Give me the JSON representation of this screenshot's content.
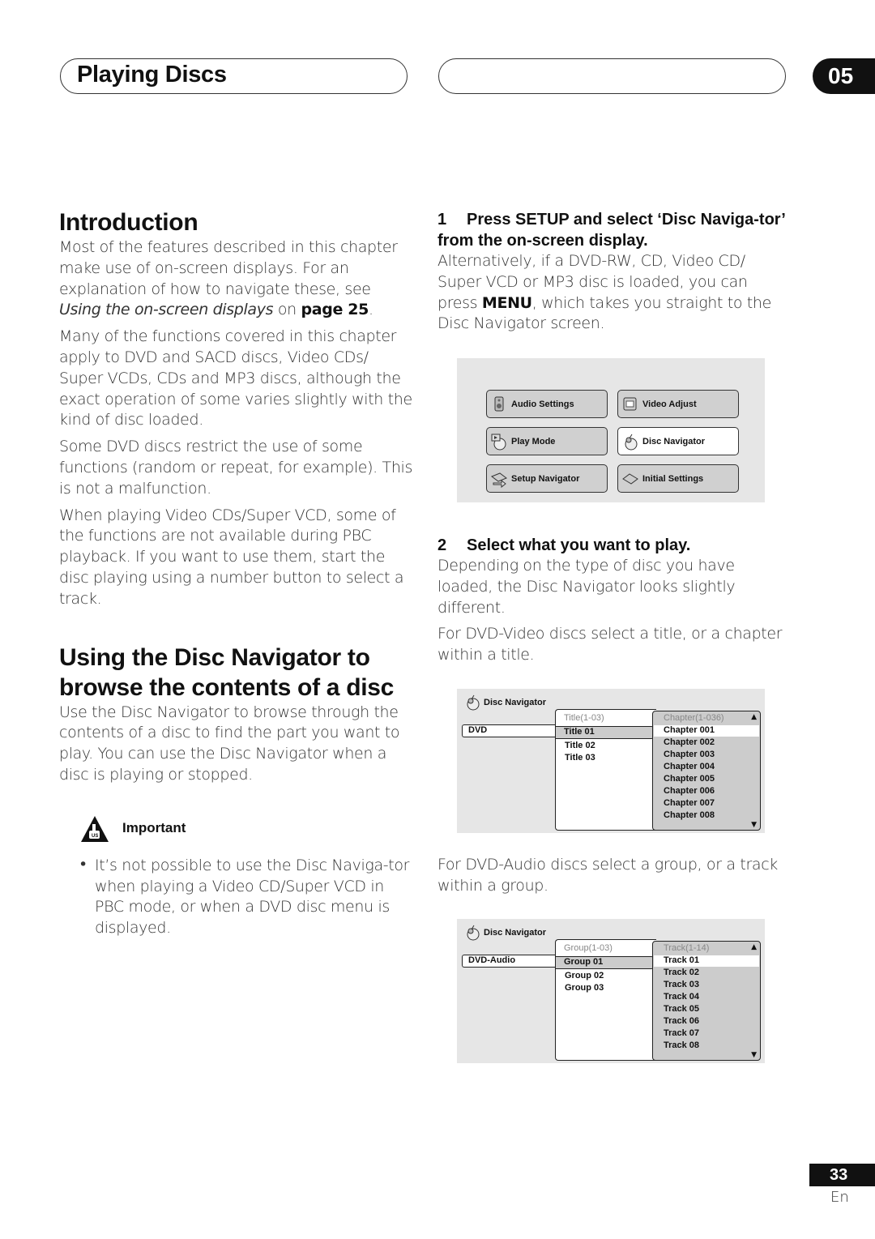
{
  "header": {
    "section_title": "Playing Discs",
    "chapter_number": "05"
  },
  "intro": {
    "heading": "Introduction",
    "p1_text": "Most of the features described in this chapter make use of on-screen displays. For an explanation of how to navigate these, see ",
    "p1_ref_italic": "Using the on-screen displays",
    "p1_on": " on ",
    "p1_page": "page 25",
    "p1_end": ".",
    "p2": "Many of the functions covered in this chapter apply to DVD and SACD discs, Video CDs/ Super VCDs, CDs and MP3 discs, although the exact operation of some varies slightly with the kind of disc loaded.",
    "p3": "Some DVD discs restrict the use of some functions (random or repeat, for example). This is not a malfunction.",
    "p4": "When playing Video CDs/Super VCD, some of the functions are not available during PBC playback. If you want to use them, start the disc playing using a number button to select a track."
  },
  "disc_nav_section": {
    "heading": "Using the Disc Navigator to browse the contents of a disc",
    "p1": "Use the Disc Navigator to browse through the contents of a disc to find the part you want to play. You can use the Disc Navigator when a disc is playing or stopped.",
    "important_label": "Important",
    "important_bullet": "It’s not possible to use the Disc Naviga-tor when playing a Video CD/Super VCD in PBC mode, or when a DVD disc menu is displayed."
  },
  "step1": {
    "number": "1",
    "title": "Press SETUP and select ‘Disc Naviga-tor’ from the on-screen display.",
    "text_a": "Alternatively, if a DVD-RW, CD, Video CD/ Super VCD or MP3 disc is loaded, you can press ",
    "text_bold": "MENU",
    "text_b": ", which takes you straight to the Disc Navigator screen."
  },
  "setup_menu": {
    "buttons": [
      {
        "label": "Audio Settings",
        "icon": "speaker-icon",
        "active": false
      },
      {
        "label": "Video Adjust",
        "icon": "monitor-icon",
        "active": false
      },
      {
        "label": "Play Mode",
        "icon": "play-mode-disc-icon",
        "active": false
      },
      {
        "label": "Disc Navigator",
        "icon": "disc-navigator-icon",
        "active": true
      },
      {
        "label": "Setup Navigator",
        "icon": "setup-navigator-icon",
        "active": false
      },
      {
        "label": "Initial Settings",
        "icon": "initial-settings-icon",
        "active": false
      }
    ]
  },
  "step2": {
    "number": "2",
    "title": "Select what you want to play.",
    "p1": "Depending on the type of disc you have loaded, the Disc Navigator looks slightly different.",
    "p2": "For DVD-Video discs select a title, or a chapter within a title.",
    "p3": "For DVD-Audio discs select a group, or a track within a group."
  },
  "dvd_navigator": {
    "title": "Disc Navigator",
    "disc_type": "DVD",
    "mid_header": "Title(1-03)",
    "mid_items": [
      "Title 01",
      "Title 02",
      "Title 03"
    ],
    "right_header": "Chapter(1-036)",
    "right_items": [
      "Chapter 001",
      "Chapter 002",
      "Chapter 003",
      "Chapter 004",
      "Chapter 005",
      "Chapter 006",
      "Chapter 007",
      "Chapter 008"
    ]
  },
  "dvda_navigator": {
    "title": "Disc Navigator",
    "disc_type": "DVD-Audio",
    "mid_header": "Group(1-03)",
    "mid_items": [
      "Group 01",
      "Group 02",
      "Group 03"
    ],
    "right_header": "Track(1-14)",
    "right_items": [
      "Track 01",
      "Track 02",
      "Track 03",
      "Track 04",
      "Track 05",
      "Track 06",
      "Track 07",
      "Track 08"
    ]
  },
  "footer": {
    "page_number": "33",
    "language": "En"
  }
}
